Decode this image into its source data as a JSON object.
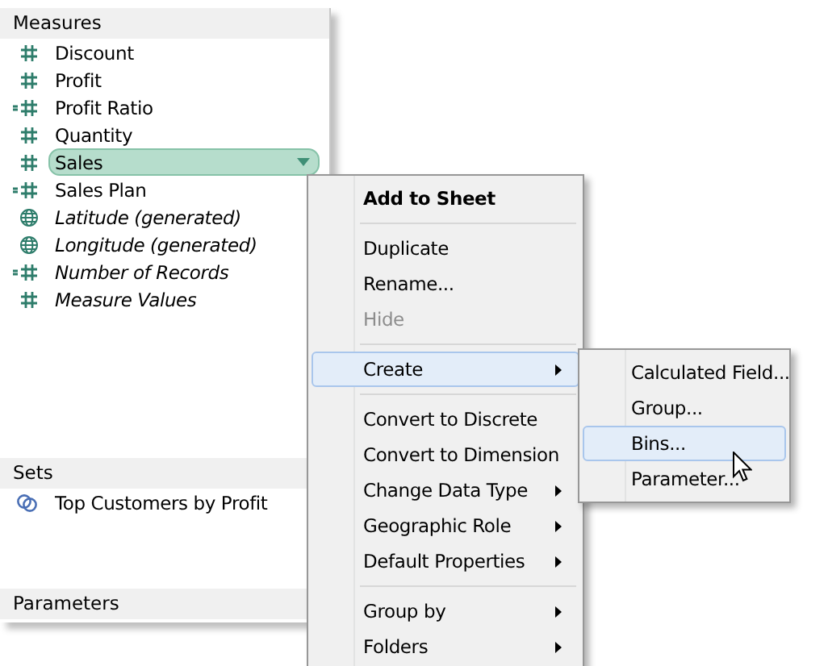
{
  "panel": {
    "sections": [
      {
        "title": "Measures",
        "items": [
          {
            "label": "Discount",
            "kind": "measure",
            "generated": false,
            "selected": false
          },
          {
            "label": "Profit",
            "kind": "measure",
            "generated": false,
            "selected": false
          },
          {
            "label": "Profit Ratio",
            "kind": "calculated",
            "generated": false,
            "selected": false
          },
          {
            "label": "Quantity",
            "kind": "measure",
            "generated": false,
            "selected": false
          },
          {
            "label": "Sales",
            "kind": "measure",
            "generated": false,
            "selected": true
          },
          {
            "label": "Sales Plan",
            "kind": "calculated",
            "generated": false,
            "selected": false
          },
          {
            "label": "Latitude (generated)",
            "kind": "geo",
            "generated": true,
            "selected": false
          },
          {
            "label": "Longitude (generated)",
            "kind": "geo",
            "generated": true,
            "selected": false
          },
          {
            "label": "Number of Records",
            "kind": "calculated",
            "generated": true,
            "selected": false
          },
          {
            "label": "Measure Values",
            "kind": "measure",
            "generated": true,
            "selected": false
          }
        ]
      },
      {
        "title": "Sets",
        "items": [
          {
            "label": "Top Customers by Profit",
            "kind": "set",
            "generated": false,
            "selected": false
          }
        ]
      },
      {
        "title": "Parameters"
      }
    ]
  },
  "context_menu": {
    "items": [
      {
        "kind": "item",
        "label": "Add to Sheet",
        "default": true,
        "disabled": false,
        "selected": false,
        "submenu": false
      },
      {
        "kind": "separator"
      },
      {
        "kind": "item",
        "label": "Duplicate",
        "default": false,
        "disabled": false,
        "selected": false,
        "submenu": false
      },
      {
        "kind": "item",
        "label": "Rename...",
        "default": false,
        "disabled": false,
        "selected": false,
        "submenu": false
      },
      {
        "kind": "item",
        "label": "Hide",
        "default": false,
        "disabled": true,
        "selected": false,
        "submenu": false
      },
      {
        "kind": "separator"
      },
      {
        "kind": "item",
        "label": "Create",
        "default": false,
        "disabled": false,
        "selected": true,
        "submenu": true
      },
      {
        "kind": "separator"
      },
      {
        "kind": "item",
        "label": "Convert to Discrete",
        "default": false,
        "disabled": false,
        "selected": false,
        "submenu": false
      },
      {
        "kind": "item",
        "label": "Convert to Dimension",
        "default": false,
        "disabled": false,
        "selected": false,
        "submenu": false
      },
      {
        "kind": "item",
        "label": "Change Data Type",
        "default": false,
        "disabled": false,
        "selected": false,
        "submenu": true
      },
      {
        "kind": "item",
        "label": "Geographic Role",
        "default": false,
        "disabled": false,
        "selected": false,
        "submenu": true
      },
      {
        "kind": "item",
        "label": "Default Properties",
        "default": false,
        "disabled": false,
        "selected": false,
        "submenu": true
      },
      {
        "kind": "separator"
      },
      {
        "kind": "item",
        "label": "Group by",
        "default": false,
        "disabled": false,
        "selected": false,
        "submenu": true
      },
      {
        "kind": "item",
        "label": "Folders",
        "default": false,
        "disabled": false,
        "selected": false,
        "submenu": true
      }
    ]
  },
  "submenu": {
    "items": [
      {
        "label": "Calculated Field...",
        "selected": false
      },
      {
        "label": "Group...",
        "selected": false
      },
      {
        "label": "Bins...",
        "selected": true
      },
      {
        "label": "Parameter...",
        "selected": false
      }
    ]
  }
}
